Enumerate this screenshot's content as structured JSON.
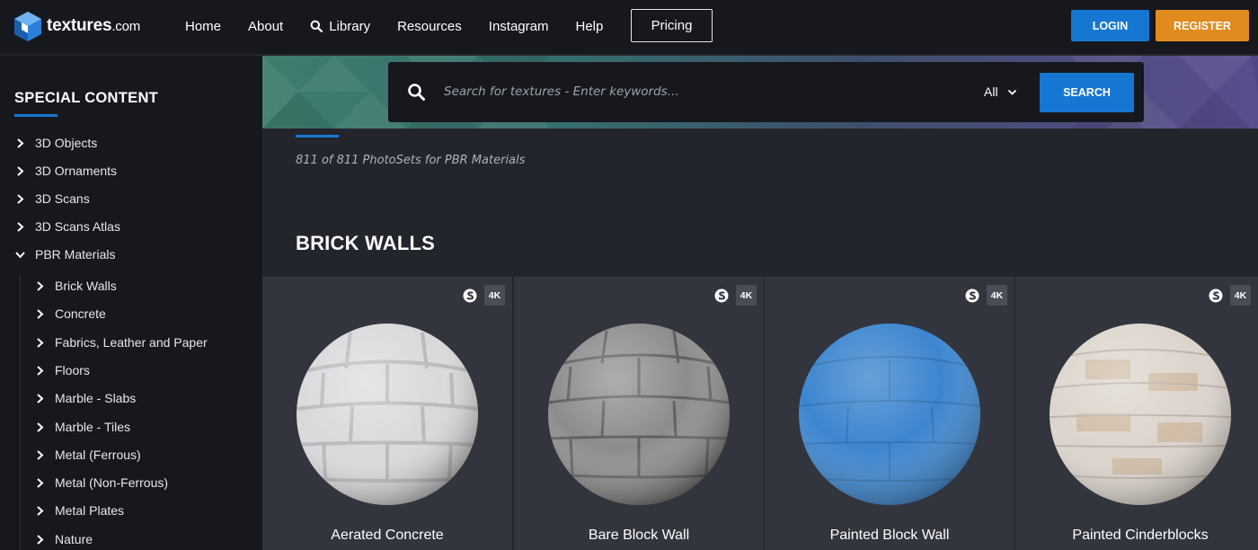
{
  "brand": {
    "name": "textures",
    "suffix": ".com"
  },
  "nav": {
    "items": [
      {
        "label": "Home",
        "icon": ""
      },
      {
        "label": "About",
        "icon": ""
      },
      {
        "label": "Library",
        "icon": "search-icon"
      },
      {
        "label": "Resources",
        "icon": ""
      },
      {
        "label": "Instagram",
        "icon": ""
      },
      {
        "label": "Help",
        "icon": ""
      }
    ],
    "pricing": "Pricing",
    "login": "LOGIN",
    "register": "REGISTER"
  },
  "sidebar": {
    "title": "SPECIAL CONTENT",
    "items": [
      {
        "label": "3D Objects",
        "state": "collapsed"
      },
      {
        "label": "3D Ornaments",
        "state": "collapsed"
      },
      {
        "label": "3D Scans",
        "state": "collapsed"
      },
      {
        "label": "3D Scans Atlas",
        "state": "collapsed"
      },
      {
        "label": "PBR Materials",
        "state": "expanded"
      }
    ],
    "subitems": [
      {
        "label": "Brick Walls"
      },
      {
        "label": "Concrete"
      },
      {
        "label": "Fabrics, Leather and Paper"
      },
      {
        "label": "Floors"
      },
      {
        "label": "Marble - Slabs"
      },
      {
        "label": "Marble - Tiles"
      },
      {
        "label": "Metal (Ferrous)"
      },
      {
        "label": "Metal (Non-Ferrous)"
      },
      {
        "label": "Metal Plates"
      },
      {
        "label": "Nature"
      }
    ]
  },
  "search": {
    "placeholder": "Search for textures - Enter keywords...",
    "filter": "All",
    "button": "SEARCH"
  },
  "results": {
    "count_text": "811 of 811 PhotoSets for PBR Materials",
    "section_title": "BRICK WALLS"
  },
  "cards": [
    {
      "title": "Aerated Concrete",
      "badge": "4K",
      "color": "#d9d9db"
    },
    {
      "title": "Bare Block Wall",
      "badge": "4K",
      "color": "#8c8c8c"
    },
    {
      "title": "Painted Block Wall",
      "badge": "4K",
      "color": "#3d86cf"
    },
    {
      "title": "Painted Cinderblocks",
      "badge": "4K",
      "color": "#dcd4cc"
    }
  ],
  "colors": {
    "accent": "#1677d2",
    "register": "#e18a1d",
    "panel": "#16181d",
    "page": "#23252c",
    "card": "#32353d"
  }
}
